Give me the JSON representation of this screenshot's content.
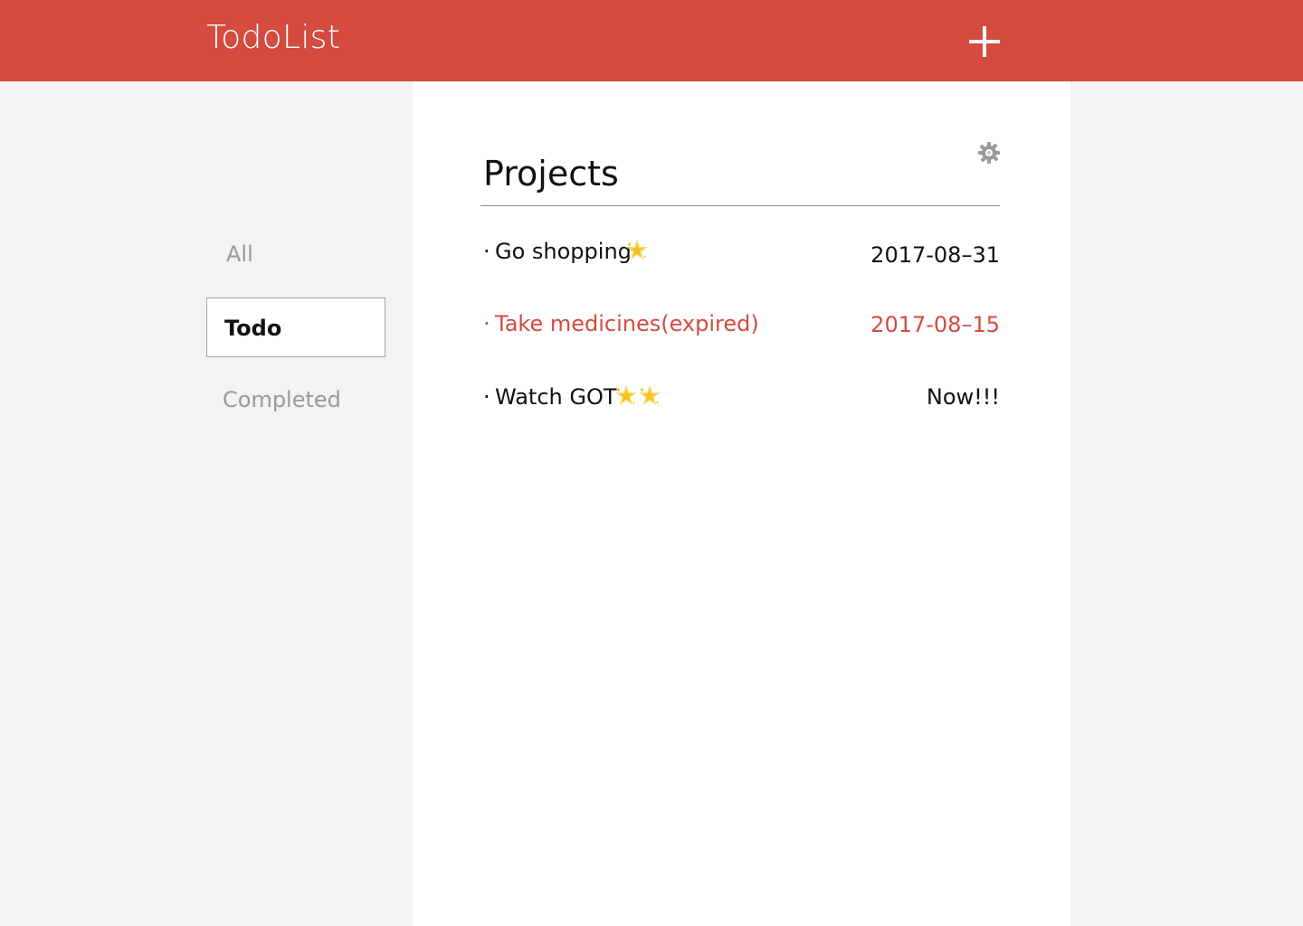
{
  "header": {
    "title": "TodoList",
    "add_icon": "plus-icon",
    "background_color": "#d44b3f"
  },
  "sidebar": {
    "filters": [
      {
        "label": "All",
        "state": "inactive"
      },
      {
        "label": "Todo",
        "state": "active"
      },
      {
        "label": "Completed",
        "state": "inactive"
      }
    ]
  },
  "main": {
    "title": "Projects",
    "settings_icon": "gear-icon",
    "tasks": [
      {
        "bullet": "·",
        "name": "Go shopping",
        "stars": 1,
        "date": "2017-08–31",
        "status": "normal"
      },
      {
        "bullet": "·",
        "name": "Take medicines(expired)",
        "stars": 0,
        "date": "2017-08–15",
        "status": "expired"
      },
      {
        "bullet": "·",
        "name": "Watch GOT",
        "stars": 2,
        "date": "Now!!!",
        "status": "normal"
      }
    ]
  },
  "colors": {
    "accent": "#d44b3f",
    "sidebar_background": "#f3f3f3",
    "panel_background": "#ffffff",
    "star": "#f4c21f"
  }
}
